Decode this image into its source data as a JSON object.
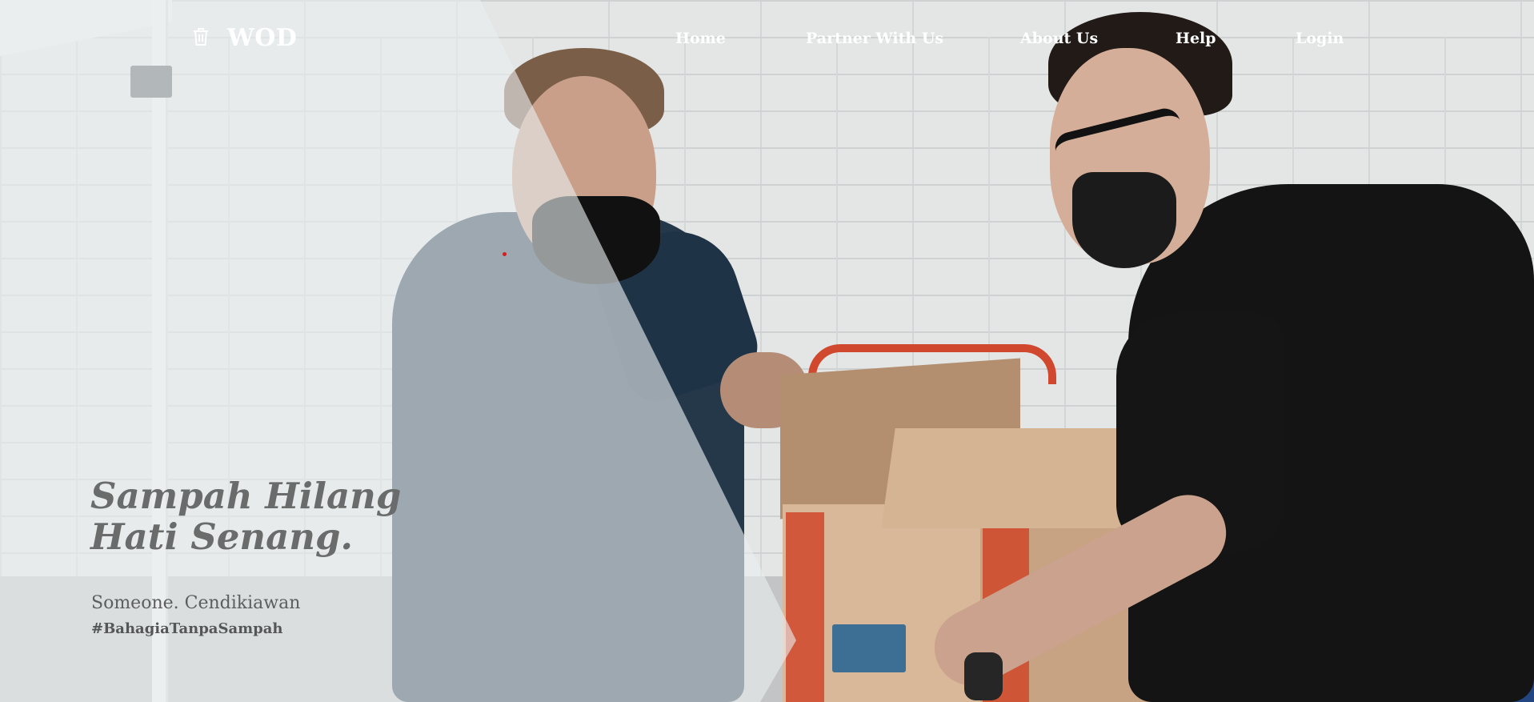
{
  "brand": {
    "name": "WOD",
    "icon": "trash-icon",
    "color": "#ffffff"
  },
  "nav": {
    "items": [
      {
        "label": "Home"
      },
      {
        "label": "Partner With Us"
      },
      {
        "label": "About Us"
      },
      {
        "label": "Help"
      },
      {
        "label": "Login"
      }
    ]
  },
  "hero": {
    "headline_line1": "Sampah Hilang",
    "headline_line2": "Hati Senang.",
    "author": "Someone. Cendikiawan",
    "hashtag": "#BahagiaTanpaSampah",
    "background_image": "two-men-handing-cardboard-box-photo"
  },
  "colors": {
    "overlay": "rgba(233,237,239,0.62)",
    "headline": "#6a6b6b",
    "nav_text": "#ffffff"
  }
}
